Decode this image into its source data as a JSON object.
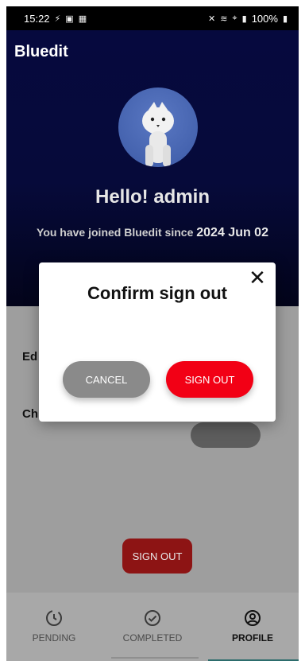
{
  "status": {
    "time": "15:22",
    "left_icons": [
      "fantasy-icon",
      "cast-icon",
      "gallery-icon"
    ],
    "right_icons": [
      "mute-icon",
      "wifi-icon",
      "hotspot-icon",
      "signal-icon"
    ],
    "battery": "100%"
  },
  "app": {
    "title": "Bluedit"
  },
  "profile": {
    "greeting": "Hello! admin",
    "joined_prefix": "You have joined Bluedit since",
    "joined_date": "2024 Jun 02"
  },
  "content": {
    "row1_label": "Ed",
    "row2_label": "Ch",
    "signout_label": "SIGN OUT"
  },
  "modal": {
    "title": "Confirm sign out",
    "cancel": "CANCEL",
    "signout": "SIGN OUT",
    "close_icon": "close-icon"
  },
  "nav": {
    "pending": "PENDING",
    "completed": "COMPLETED",
    "profile": "PROFILE",
    "active": "PROFILE"
  },
  "colors": {
    "hero": "#06093e",
    "modal_signout": "#f20015",
    "modal_cancel": "#8a8a8a",
    "nav_underline": "#2c6c6c"
  }
}
